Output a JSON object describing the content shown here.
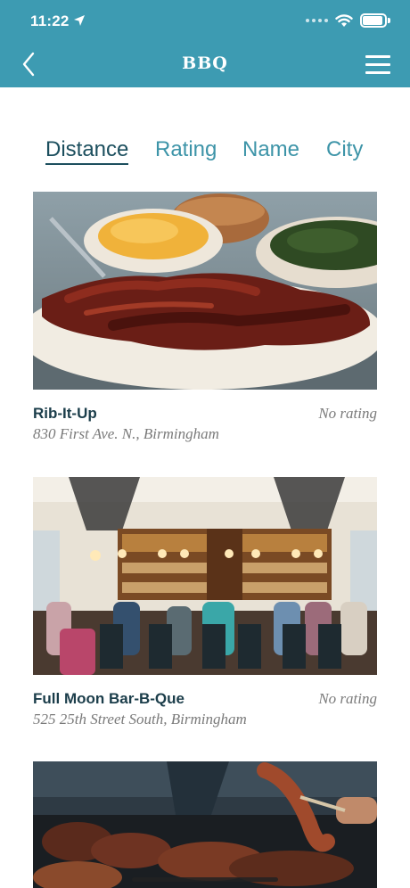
{
  "status_bar": {
    "time": "11:22",
    "icons": [
      "location-arrow-icon",
      "cellular-signal-icon",
      "wifi-icon",
      "battery-icon"
    ]
  },
  "nav": {
    "title": "BBQ",
    "back_icon": "chevron-left-icon",
    "menu_icon": "hamburger-menu-icon"
  },
  "sort_tabs": [
    {
      "label": "Distance",
      "active": true
    },
    {
      "label": "Rating",
      "active": false
    },
    {
      "label": "Name",
      "active": false
    },
    {
      "label": "City",
      "active": false
    }
  ],
  "listings": [
    {
      "name": "Rib-It-Up",
      "address": "830 First Ave. N., Birmingham",
      "rating": "No rating",
      "photo": "plate of ribs with mac and cheese and greens"
    },
    {
      "name": "Full Moon Bar-B-Que",
      "address": "525 25th Street South, Birmingham",
      "rating": "No rating",
      "photo": "restaurant interior with diners and bar"
    },
    {
      "name": "",
      "address": "",
      "rating": "",
      "photo": "meat on a grill"
    }
  ],
  "colors": {
    "header": "#3d9bb2",
    "tab": "#3d94a8",
    "tab_active": "#1c4f5e",
    "name": "#1b3d4a",
    "muted": "#7a7a7a"
  }
}
